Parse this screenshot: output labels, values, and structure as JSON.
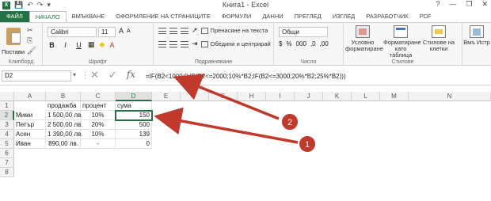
{
  "window": {
    "title": "Книга1 - Excel",
    "minimize": "—",
    "restore": "❐",
    "close": "✕",
    "help": "?"
  },
  "qat": {
    "save": "💾",
    "undo": "↶",
    "redo": "↷",
    "customize": "▾"
  },
  "tabs": [
    "ФАЙЛ",
    "НАЧАЛО",
    "ВМЪКВАНЕ",
    "ОФОРМЛЕНИЕ НА СТРАНИЦИТЕ",
    "ФОРМУЛИ",
    "ДАННИ",
    "ПРЕГЛЕД",
    "ИЗГЛЕД",
    "РАЗРАБОТЧИК",
    "PDF"
  ],
  "ribbon": {
    "clipboard": {
      "paste": "Постави",
      "label": "Клипборд"
    },
    "font": {
      "name": "Calibri",
      "size": "11",
      "bold": "B",
      "italic": "I",
      "underline": "U",
      "grow": "A",
      "shrink": "A",
      "label": "Шрифт"
    },
    "alignment": {
      "wrap": "Пренасяне на текста",
      "merge": "Обедини и центрирай",
      "label": "Подравняване"
    },
    "number": {
      "format": "Общи",
      "currency": "$",
      "percent": "%",
      "comma": "000",
      "inc": ",0",
      "dec": ",00",
      "label": "Число"
    },
    "styles": {
      "conditional": "Условно форматиране",
      "format_table": "Форматиране като таблица",
      "cell_styles": "Стилове на клетки",
      "label": "Стилове"
    },
    "cells": {
      "insert": "Вмъ Истр"
    }
  },
  "formula_bar": {
    "name_box": "D2",
    "cancel": "✕",
    "enter": "✓",
    "fx": "fx",
    "formula": "=IF(B2<1000;0;IF(B2<=2000;10%*B2;IF(B2<=3000;20%*B2;25%*B2)))"
  },
  "columns": [
    "A",
    "B",
    "C",
    "D",
    "E",
    "F",
    "G",
    "H",
    "I",
    "J",
    "K",
    "L",
    "M",
    "N"
  ],
  "rows": [
    "1",
    "2",
    "3",
    "4",
    "5",
    "6",
    "7",
    "8"
  ],
  "cells": {
    "headers": {
      "b": "продажба",
      "c": "процент",
      "d": "сума"
    },
    "data": [
      {
        "a": "Мими",
        "b": "1 500,00 лв.",
        "c": "10%",
        "d": "150"
      },
      {
        "a": "Петър",
        "b": "2 500,00 лв.",
        "c": "20%",
        "d": "500"
      },
      {
        "a": "Асен",
        "b": "1 390,00 лв.",
        "c": "10%",
        "d": "139"
      },
      {
        "a": "Иван",
        "b": "890,00 лв.",
        "c": "-",
        "d": "0"
      }
    ]
  },
  "annotations": {
    "callout_1": "1",
    "callout_2": "2",
    "arrow_color": "#c0392b"
  }
}
